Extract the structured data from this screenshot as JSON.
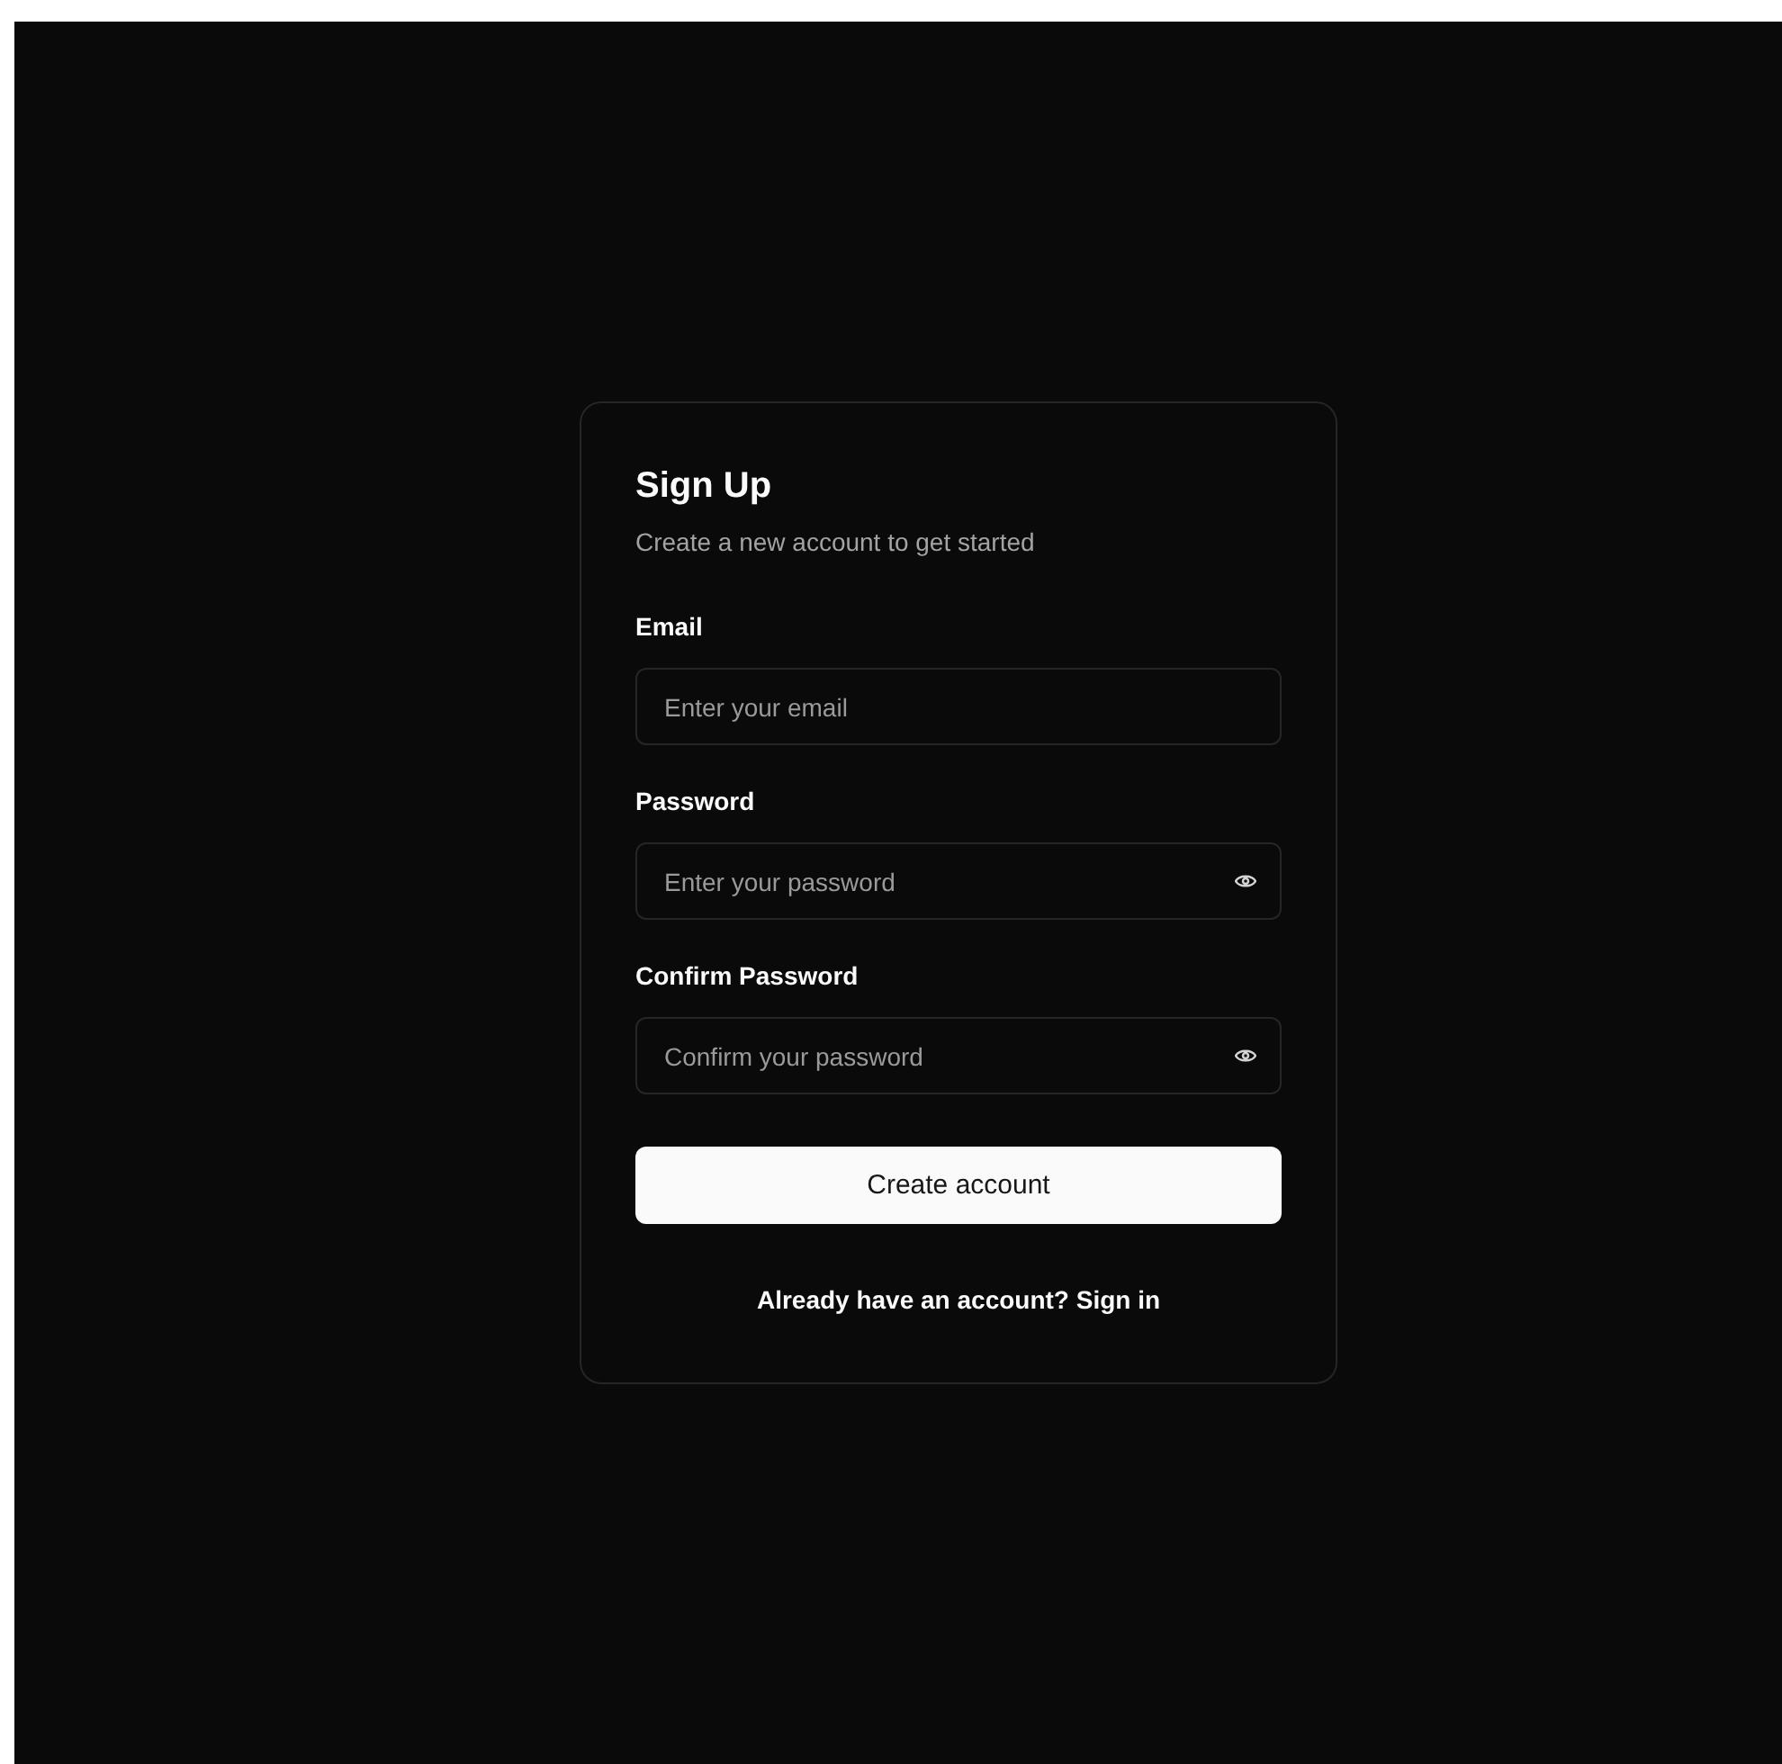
{
  "card": {
    "title": "Sign Up",
    "subtitle": "Create a new account to get started"
  },
  "fields": [
    {
      "label": "Email",
      "placeholder": "Enter your email",
      "kind": "text"
    },
    {
      "label": "Password",
      "placeholder": "Enter your password",
      "kind": "password"
    },
    {
      "label": "Confirm Password",
      "placeholder": "Confirm your password",
      "kind": "password"
    }
  ],
  "submit_button": "Create account",
  "sign_in_link": "Already have an account? Sign in"
}
